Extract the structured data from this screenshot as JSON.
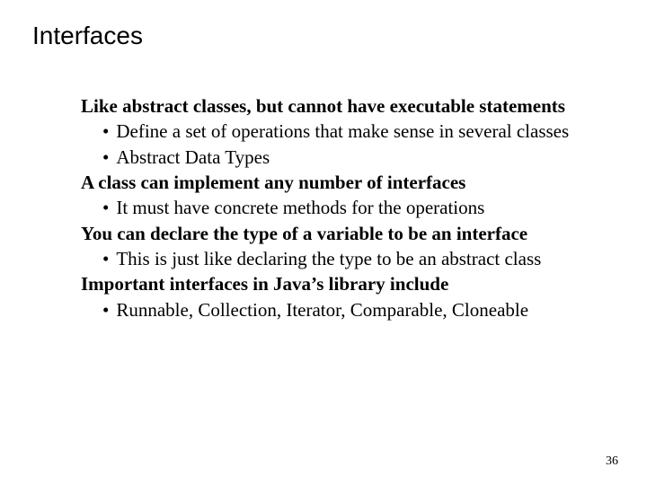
{
  "title": "Interfaces",
  "content": {
    "lead1": "Like abstract classes, but cannot have executable statements",
    "b1a": "Define a set of operations that make sense in several classes",
    "b1b": "Abstract Data Types",
    "lead2": "A class can implement any number of interfaces",
    "b2a": "It must have concrete methods for the operations",
    "lead3": "You can declare the type of a variable to be an interface",
    "b3a": "This is just like declaring the type to be an abstract class",
    "lead4": "Important interfaces in Java’s library include",
    "b4a": "Runnable, Collection, Iterator, Comparable, Cloneable"
  },
  "bullet_char": "•",
  "page_number": "36"
}
